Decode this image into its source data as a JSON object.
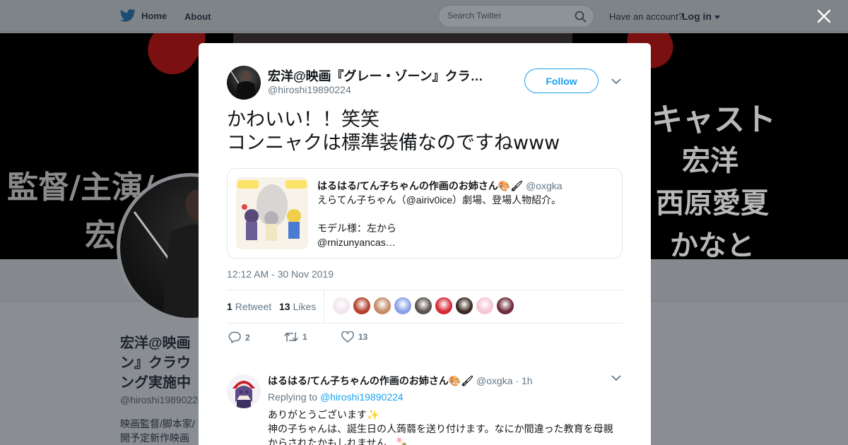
{
  "nav": {
    "home_label": "Home",
    "about_label": "About",
    "search_placeholder": "Search Twitter",
    "have_account": "Have an account?",
    "login_label": "Log in"
  },
  "background_profile": {
    "banner_left_lines": [
      "監督/主演/",
      "宏"
    ],
    "banner_right_lines": [
      "キャスト",
      "宏洋",
      "西原愛夏",
      "かなと"
    ],
    "name": "宏洋@映画『グレー・ゾーン』クラウドファンディング実施中",
    "name_visible_lines": [
      "宏洋@映画",
      "ン』クラウ",
      "ング実施中"
    ],
    "handle": "@hiroshi19890224",
    "bio_visible_lines": [
      "映画監督/脚本家/",
      "開予定新作映画『"
    ]
  },
  "tweet": {
    "author_name": "宏洋@映画『グレー・ゾーン』クラ…",
    "author_handle": "@hiroshi19890224",
    "follow_label": "Follow",
    "text": "かわいい！！笑笑\nコンニャクは標準装備なのですねwww",
    "quote": {
      "name": "はるはる/てん子ちゃんの作画のお姉さん🎨🖌",
      "handle": "@oxgka",
      "text": "えらてん子ちゃん（@airiv0ice）劇場、登場人物紹介。\n\nモデル様：左から\n@rnizunyancas…"
    },
    "timestamp": "12:12 AM - 30 Nov 2019",
    "retweet_count": "1",
    "retweet_label": "Retweet",
    "likes_count": "13",
    "likes_label": "Likes",
    "liker_colors": [
      "#f3e6ee",
      "#b3412c",
      "#c48a67",
      "#8aa0e8",
      "#5b5150",
      "#d62a35",
      "#3a2a22",
      "#f5c5d6",
      "#6e2b3a"
    ],
    "reply_count": "2",
    "retweet_action_count": "1",
    "like_action_count": "13"
  },
  "reply": {
    "name": "はるはる/てん子ちゃんの作画のお姉さん🎨🖌",
    "handle": "@oxgka",
    "time": "1h",
    "replying_to_label": "Replying to",
    "replying_to_handle": "@hiroshi19890224",
    "text": "ありがとうございます✨\n神の子ちゃんは、誕生日の人蒟蒻を送り付けます。なにか間違った教育を母親\nからされたかもしれません…🍡"
  }
}
